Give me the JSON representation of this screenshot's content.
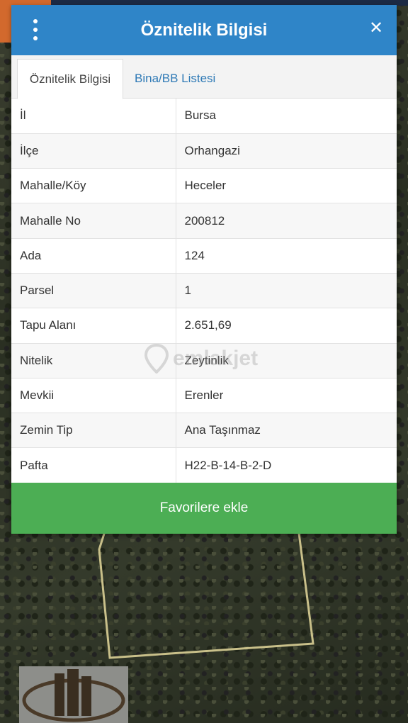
{
  "dialog": {
    "title": "Öznitelik Bilgisi",
    "close_symbol": "✕",
    "menu_icon": "vertical-dots-icon"
  },
  "tabs": [
    {
      "label": "Öznitelik Bilgisi",
      "active": true
    },
    {
      "label": "Bina/BB Listesi",
      "active": false
    }
  ],
  "attributes": [
    {
      "key": "İl",
      "value": "Bursa"
    },
    {
      "key": "İlçe",
      "value": "Orhangazi"
    },
    {
      "key": "Mahalle/Köy",
      "value": "Heceler"
    },
    {
      "key": "Mahalle No",
      "value": "200812"
    },
    {
      "key": "Ada",
      "value": "124"
    },
    {
      "key": "Parsel",
      "value": "1"
    },
    {
      "key": "Tapu Alanı",
      "value": "2.651,69"
    },
    {
      "key": "Nitelik",
      "value": "Zeytinlik"
    },
    {
      "key": "Mevkii",
      "value": "Erenler"
    },
    {
      "key": "Zemin Tip",
      "value": "Ana Taşınmaz"
    },
    {
      "key": "Pafta",
      "value": "H22-B-14-B-2-D"
    }
  ],
  "favorite_button": {
    "label": "Favorilere ekle"
  },
  "watermark": {
    "text": "emlakjet"
  },
  "colors": {
    "header": "#2f85c8",
    "favorite": "#4cae54",
    "tab_inactive_text": "#2f7ab6",
    "parcel_outline": "#c9c08a"
  }
}
